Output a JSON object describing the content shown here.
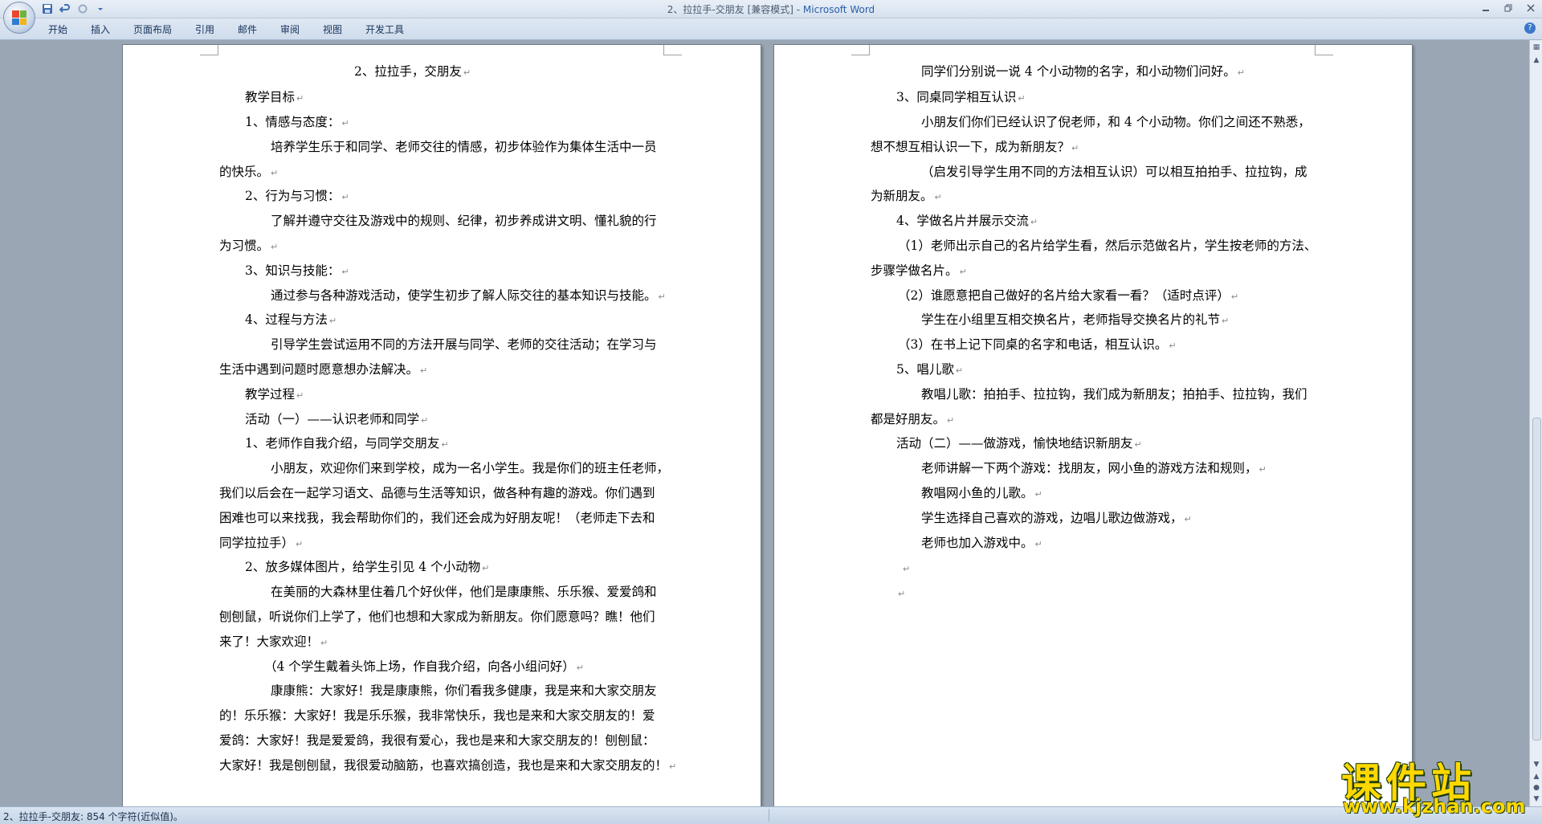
{
  "window": {
    "title_doc": "2、拉拉手-交朋友 [兼容模式] - ",
    "title_app": "Microsoft Word"
  },
  "qat": {
    "save_icon": "save-icon",
    "undo_icon": "undo-icon",
    "redo_icon": "redo-icon",
    "customize_icon": "customize-icon"
  },
  "ribbon": {
    "tabs": [
      "开始",
      "插入",
      "页面布局",
      "引用",
      "邮件",
      "审阅",
      "视图",
      "开发工具"
    ]
  },
  "left_page": {
    "lines": [
      "2、拉拉手，交朋友",
      "教学目标",
      "1、情感与态度：",
      "培养学生乐于和同学、老师交往的情感，初步体验作为集体生活中一员",
      "的快乐。",
      "2、行为与习惯：",
      "了解并遵守交往及游戏中的规则、纪律，初步养成讲文明、懂礼貌的行",
      "为习惯。",
      "3、知识与技能：",
      "通过参与各种游戏活动，使学生初步了解人际交往的基本知识与技能。",
      "4、过程与方法",
      "引导学生尝试运用不同的方法开展与同学、老师的交往活动；在学习与",
      "生活中遇到问题时愿意想办法解决。",
      "教学过程",
      "活动（一）——认识老师和同学",
      "1、老师作自我介绍，与同学交朋友",
      "小朋友，欢迎你们来到学校，成为一名小学生。我是你们的班主任老师，",
      "我们以后会在一起学习语文、品德与生活等知识，做各种有趣的游戏。你们遇到",
      "困难也可以来找我，我会帮助你们的，我们还会成为好朋友呢！（老师走下去和",
      "同学拉拉手）",
      "2、放多媒体图片，给学生引见 4 个小动物",
      "在美丽的大森林里住着几个好伙伴，他们是康康熊、乐乐猴、爱爱鸽和",
      "刨刨鼠，听说你们上学了，他们也想和大家成为新朋友。你们愿意吗？瞧！他们",
      "来了！大家欢迎！",
      "（4 个学生戴着头饰上场，作自我介绍，向各小组问好）",
      "康康熊：大家好！我是康康熊，你们看我多健康，我是来和大家交朋友",
      "的！乐乐猴：大家好！我是乐乐猴，我非常快乐，我也是来和大家交朋友的！爱",
      "爱鸽：大家好！我是爱爱鸽，我很有爱心，我也是来和大家交朋友的！刨刨鼠：",
      "大家好！我是刨刨鼠，我很爱动脑筋，也喜欢搞创造，我也是来和大家交朋友的！"
    ]
  },
  "right_page": {
    "lines": [
      "同学们分别说一说 4 个小动物的名字，和小动物们问好。",
      "3、同桌同学相互认识",
      "小朋友们你们已经认识了倪老师，和 4 个小动物。你们之间还不熟悉，",
      "想不想互相认识一下，成为新朋友？",
      "（启发引导学生用不同的方法相互认识）可以相互拍拍手、拉拉钩，成",
      "为新朋友。",
      "4、学做名片并展示交流",
      "（1）老师出示自己的名片给学生看，然后示范做名片，学生按老师的方法、",
      "步骤学做名片。",
      "（2）谁愿意把自己做好的名片给大家看一看？（适时点评）",
      "学生在小组里互相交换名片，老师指导交换名片的礼节",
      "（3）在书上记下同桌的名字和电话，相互认识。",
      "5、唱儿歌",
      "教唱儿歌：拍拍手、拉拉钩，我们成为新朋友；拍拍手、拉拉钩，我们",
      "都是好朋友。",
      "活动（二）——做游戏，愉快地结识新朋友",
      "老师讲解一下两个游戏：找朋友，网小鱼的游戏方法和规则，",
      "教唱网小鱼的儿歌。",
      "学生选择自己喜欢的游戏，边唱儿歌边做游戏，",
      "老师也加入游戏中。",
      "",
      ""
    ]
  },
  "status": {
    "text": "2、拉拉手-交朋友: 854 个字符(近似值)。"
  },
  "watermark": {
    "cn": "课件站",
    "url": "www.kjzhan.com"
  },
  "colors": {
    "title_app": "#2a5ea8",
    "workspace": "#9aa6b4",
    "watermark": "#ffd800"
  }
}
